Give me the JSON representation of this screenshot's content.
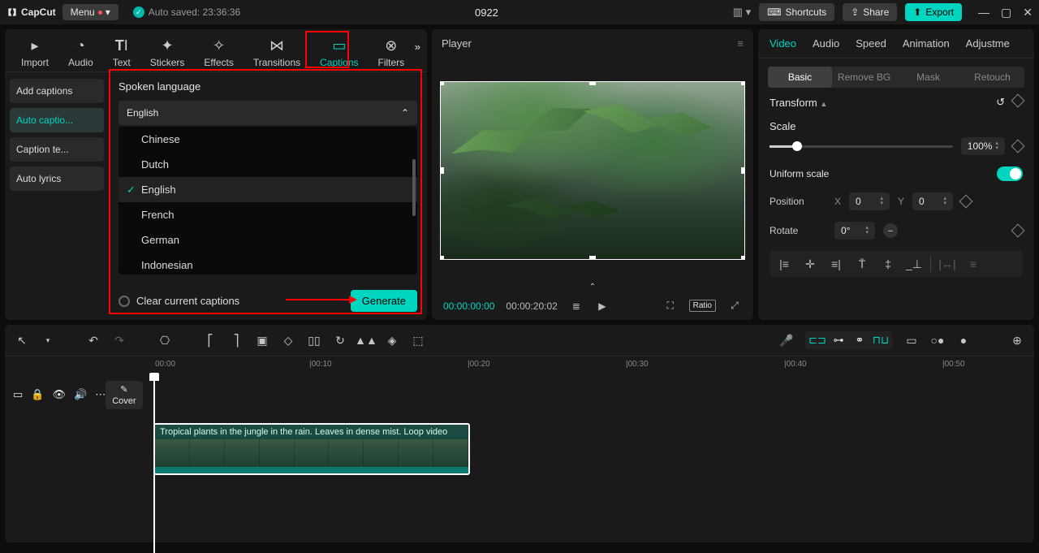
{
  "app": {
    "name": "CapCut"
  },
  "titlebar": {
    "menu": "Menu",
    "autosave": "Auto saved: 23:36:36",
    "project": "0922",
    "shortcuts": "Shortcuts",
    "share": "Share",
    "export": "Export"
  },
  "media_tabs": {
    "import": "Import",
    "audio": "Audio",
    "text": "Text",
    "stickers": "Stickers",
    "effects": "Effects",
    "transitions": "Transitions",
    "captions": "Captions",
    "filters": "Filters"
  },
  "sidebar": {
    "items": [
      "Add captions",
      "Auto captio...",
      "Caption te...",
      "Auto lyrics"
    ]
  },
  "captions": {
    "title": "Spoken language",
    "selected": "English",
    "options": [
      "Chinese",
      "Dutch",
      "English",
      "French",
      "German",
      "Indonesian"
    ],
    "clear": "Clear current captions",
    "generate": "Generate"
  },
  "player": {
    "title": "Player",
    "current": "00:00:00:00",
    "duration": "00:00:20:02",
    "ratio": "Ratio"
  },
  "inspector": {
    "tabs": [
      "Video",
      "Audio",
      "Speed",
      "Animation",
      "Adjustme"
    ],
    "subtabs": [
      "Basic",
      "Remove BG",
      "Mask",
      "Retouch"
    ],
    "transform": "Transform",
    "scale_label": "Scale",
    "scale": "100%",
    "uniform": "Uniform scale",
    "position": "Position",
    "x_label": "X",
    "x": "0",
    "y_label": "Y",
    "y": "0",
    "rotate_label": "Rotate",
    "rotate": "0°"
  },
  "timeline": {
    "ticks": [
      "00:00",
      "|00:10",
      "|00:20",
      "|00:30",
      "|00:40",
      "|00:50"
    ],
    "cover": "Cover",
    "clip_name": "Tropical plants in the jungle in the rain. Leaves in dense mist. Loop video"
  }
}
